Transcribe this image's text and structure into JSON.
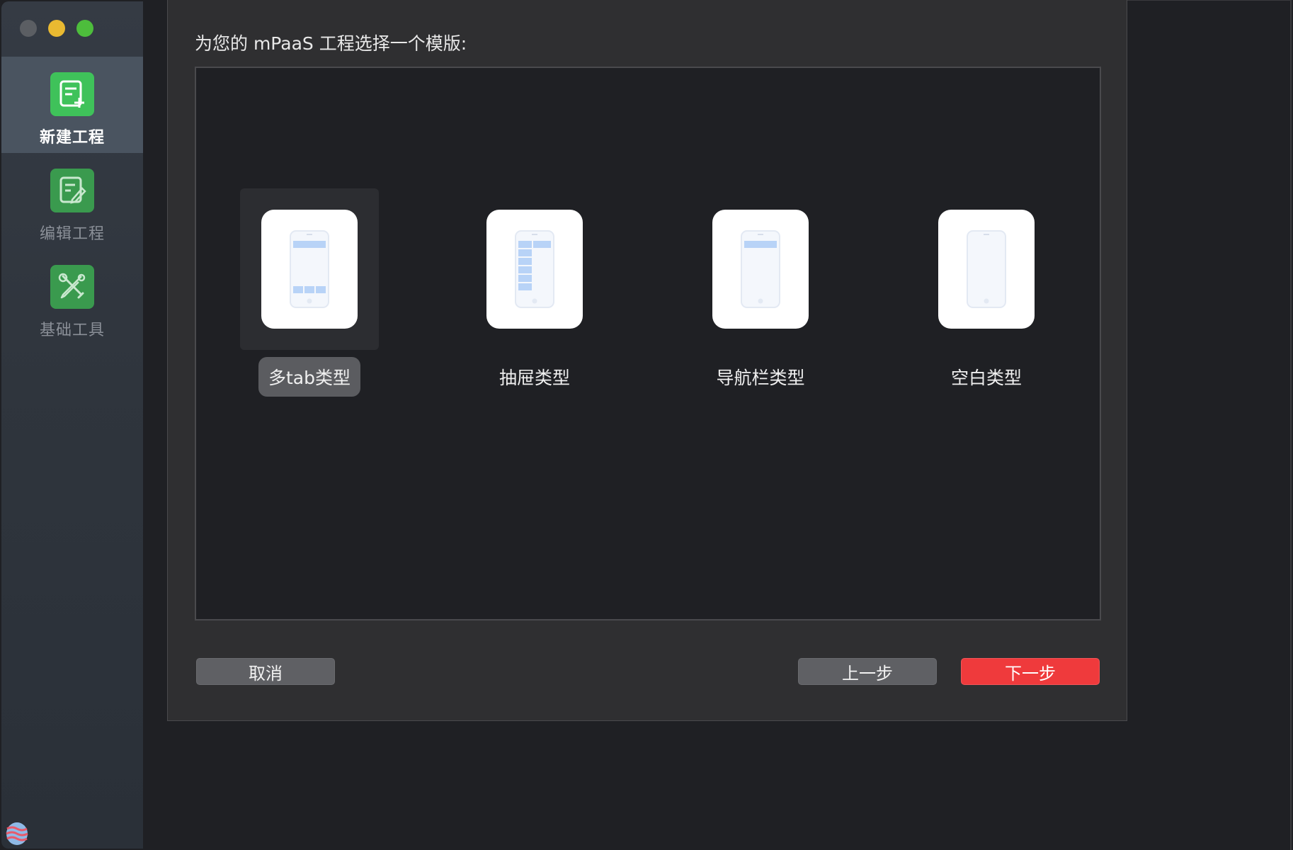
{
  "window": {
    "traffic_lights": [
      "close",
      "minimize",
      "maximize"
    ]
  },
  "sidebar": {
    "items": [
      {
        "label": "新建工程",
        "icon": "new-project-icon",
        "active": true
      },
      {
        "label": "编辑工程",
        "icon": "edit-project-icon",
        "active": false
      },
      {
        "label": "基础工具",
        "icon": "tools-icon",
        "active": false
      }
    ]
  },
  "dialog": {
    "title": "为您的 mPaaS 工程选择一个模版:",
    "templates": [
      {
        "label": "多tab类型",
        "selected": true,
        "icon": "phone-multitab-icon"
      },
      {
        "label": "抽屉类型",
        "selected": false,
        "icon": "phone-drawer-icon"
      },
      {
        "label": "导航栏类型",
        "selected": false,
        "icon": "phone-navbar-icon"
      },
      {
        "label": "空白类型",
        "selected": false,
        "icon": "phone-blank-icon"
      }
    ],
    "buttons": {
      "cancel": "取消",
      "prev": "上一步",
      "next": "下一步"
    }
  },
  "colors": {
    "accent_green": "#3fc25a",
    "primary_red": "#ef3a3c",
    "phone_blue": "#b8d3f7"
  }
}
